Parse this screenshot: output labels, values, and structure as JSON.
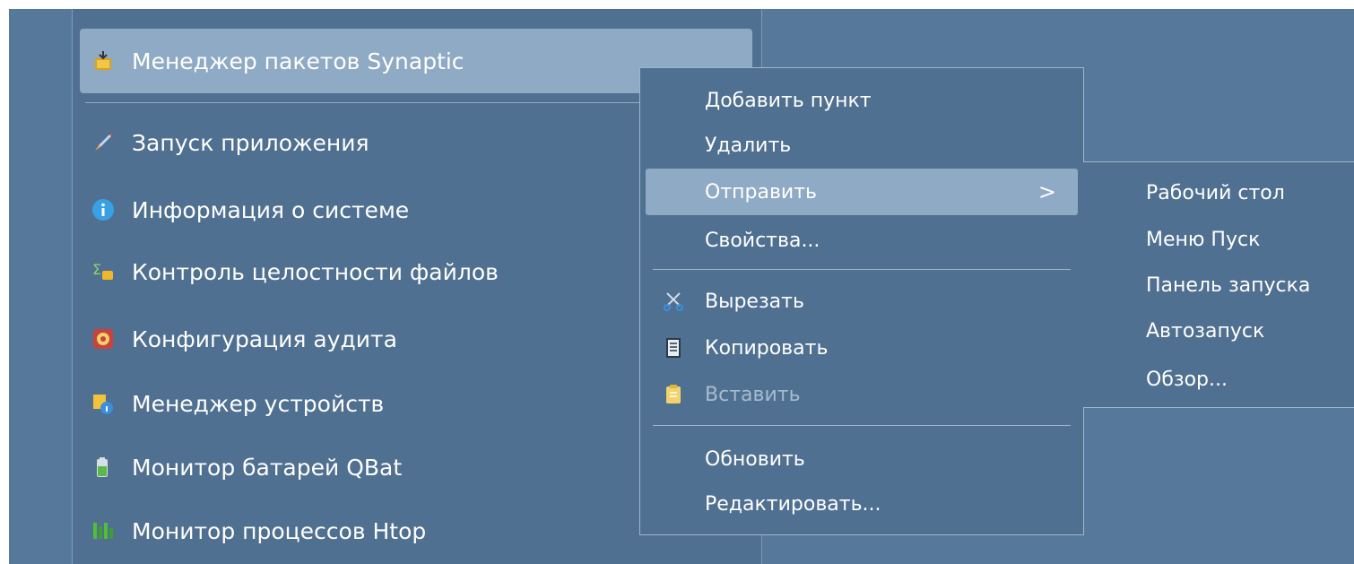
{
  "main_menu": {
    "highlighted": {
      "label": "Менеджер пакетов Synaptic",
      "icon": "package-manager-icon"
    },
    "items": [
      {
        "label": "Запуск приложения",
        "icon": "rocket-icon"
      },
      {
        "label": "Информация о системе",
        "icon": "info-icon"
      },
      {
        "label": "Контроль целостности файлов",
        "icon": "integrity-check-icon"
      },
      {
        "label": "Конфигурация аудита",
        "icon": "audit-config-icon"
      },
      {
        "label": "Менеджер устройств",
        "icon": "device-manager-icon"
      },
      {
        "label": "Монитор батарей QBat",
        "icon": "battery-icon"
      },
      {
        "label": "Монитор процессов Htop",
        "icon": "htop-icon"
      }
    ]
  },
  "context_menu": {
    "add_item": "Добавить пункт",
    "delete": "Удалить",
    "send": "Отправить",
    "send_arrow": ">",
    "properties": "Свойства...",
    "cut": "Вырезать",
    "copy": "Копировать",
    "paste": "Вставить",
    "refresh": "Обновить",
    "edit": "Редактировать..."
  },
  "send_submenu": {
    "items": [
      "Рабочий стол",
      "Меню Пуск",
      "Панель запуска",
      "Автозапуск",
      "Обзор..."
    ]
  },
  "colors": {
    "desktop": "#56799b",
    "menu_bg": "#4f7090",
    "highlight": "#8faac4",
    "disabled_text": "#a6bbcf"
  }
}
